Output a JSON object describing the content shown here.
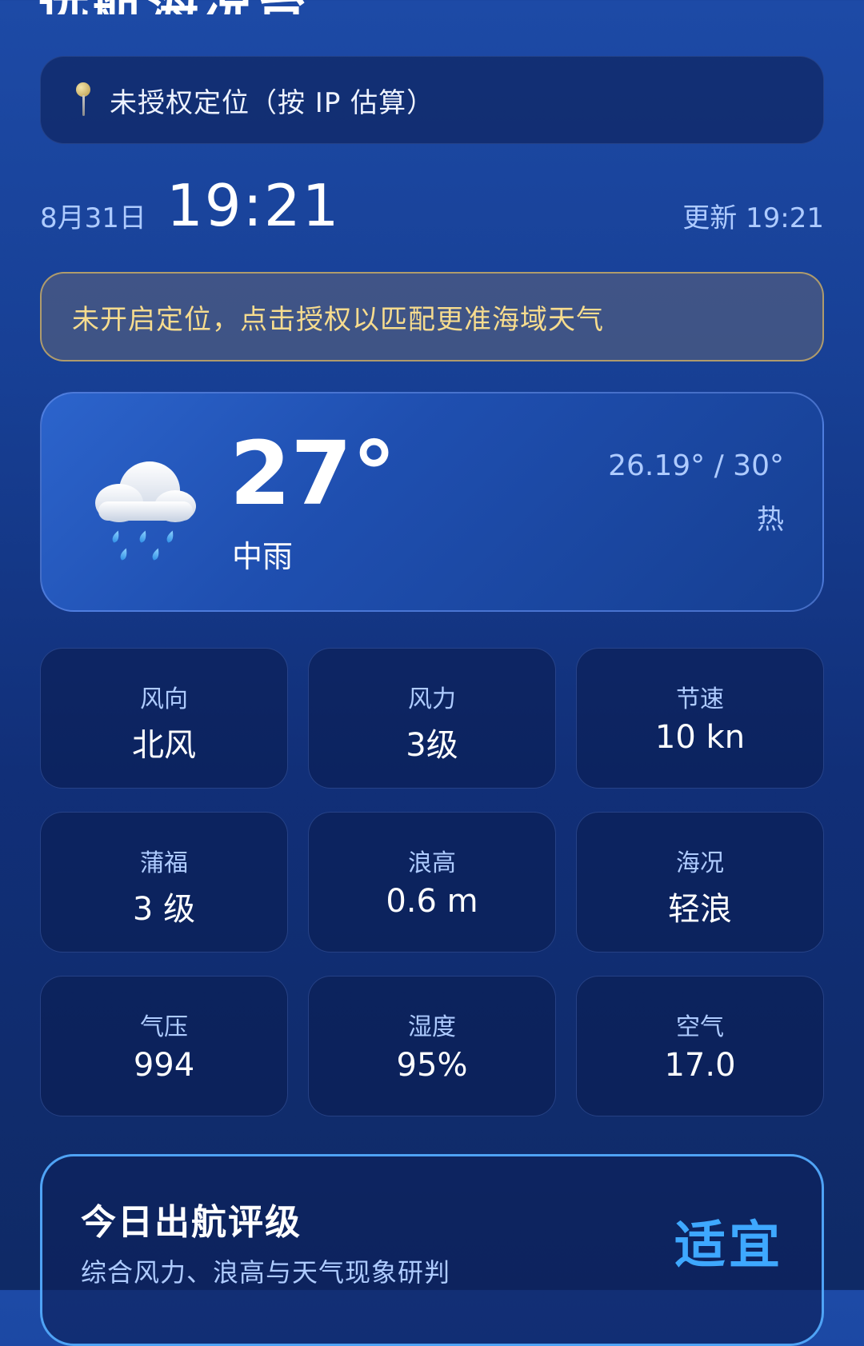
{
  "header": {
    "title": "远航海况台"
  },
  "location": {
    "icon": "pin-icon",
    "text": "未授权定位（按 IP 估算）"
  },
  "time": {
    "date": "8月31日",
    "clock": "19:21",
    "updated": "更新 19:21"
  },
  "alert": {
    "text": "未开启定位，点击授权以匹配更准海域天气",
    "border_color": "#d6b464",
    "text_color": "#f7dc8e"
  },
  "current": {
    "icon": "rain-cloud-icon",
    "temperature": "27°",
    "condition": "中雨",
    "range": "26.19° / 30°",
    "feel": "热"
  },
  "metrics": [
    {
      "label": "风向",
      "value": "北风"
    },
    {
      "label": "风力",
      "value": "3级"
    },
    {
      "label": "节速",
      "value": "10 kn"
    },
    {
      "label": "蒲福",
      "value": "3 级"
    },
    {
      "label": "浪高",
      "value": "0.6 m"
    },
    {
      "label": "海况",
      "value": "轻浪"
    },
    {
      "label": "气压",
      "value": "994"
    },
    {
      "label": "湿度",
      "value": "95%"
    },
    {
      "label": "空气",
      "value": "17.0"
    }
  ],
  "rating": {
    "title": "今日出航评级",
    "subtitle": "综合风力、浪高与天气现象研判",
    "value": "适宜",
    "accent_color": "#3ea8ff"
  }
}
